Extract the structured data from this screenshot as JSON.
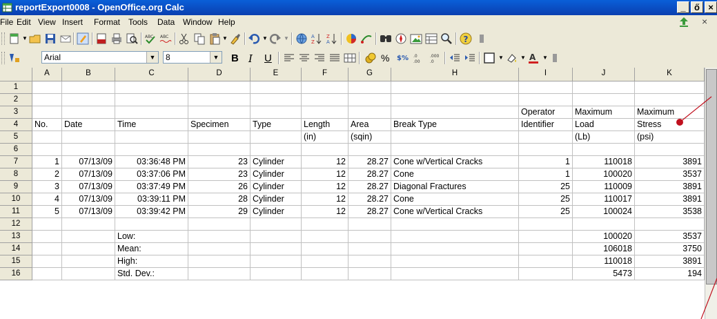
{
  "window": {
    "title": "reportExport0008 - OpenOffice.org Calc",
    "btn_min": "_",
    "btn_max": "ő",
    "btn_close": "×"
  },
  "menubar": {
    "items": [
      "File",
      "Edit",
      "View",
      "Insert",
      "Format",
      "Tools",
      "Data",
      "Window",
      "Help"
    ],
    "close": "×"
  },
  "formatting": {
    "font_name": "Arial",
    "font_size": "8",
    "bold": "B",
    "italic": "I",
    "underline": "U"
  },
  "columns": [
    "A",
    "B",
    "C",
    "D",
    "E",
    "F",
    "G",
    "H",
    "I",
    "J",
    "K"
  ],
  "rows": [
    "1",
    "2",
    "3",
    "4",
    "5",
    "6",
    "7",
    "8",
    "9",
    "10",
    "11",
    "12",
    "13",
    "14",
    "15",
    "16"
  ],
  "sheet": {
    "r3": {
      "I": "Operator",
      "J": "Maximum",
      "K": "Maximum"
    },
    "r4": {
      "A": "No.",
      "B": "Date",
      "C": "Time",
      "D": "Specimen",
      "E": "Type",
      "F": "Length",
      "G": "Area",
      "H": "Break Type",
      "I": "Identifier",
      "J": "Load",
      "K": "Stress"
    },
    "r5": {
      "F": "(in)",
      "G": "(sqin)",
      "J": "(Lb)",
      "K": "(psi)"
    },
    "data": [
      {
        "no": "1",
        "date": "07/13/09",
        "time": "03:36:48 PM",
        "specimen": "23",
        "type": "Cylinder",
        "length": "12",
        "area": "28.27",
        "break": "Cone w/Vertical Cracks",
        "operator": "1",
        "load": "110018",
        "stress": "3891"
      },
      {
        "no": "2",
        "date": "07/13/09",
        "time": "03:37:06 PM",
        "specimen": "23",
        "type": "Cylinder",
        "length": "12",
        "area": "28.27",
        "break": "Cone",
        "operator": "1",
        "load": "100020",
        "stress": "3537"
      },
      {
        "no": "3",
        "date": "07/13/09",
        "time": "03:37:49 PM",
        "specimen": "26",
        "type": "Cylinder",
        "length": "12",
        "area": "28.27",
        "break": "Diagonal Fractures",
        "operator": "25",
        "load": "110009",
        "stress": "3891"
      },
      {
        "no": "4",
        "date": "07/13/09",
        "time": "03:39:11 PM",
        "specimen": "28",
        "type": "Cylinder",
        "length": "12",
        "area": "28.27",
        "break": "Cone",
        "operator": "25",
        "load": "110017",
        "stress": "3891"
      },
      {
        "no": "5",
        "date": "07/13/09",
        "time": "03:39:42 PM",
        "specimen": "29",
        "type": "Cylinder",
        "length": "12",
        "area": "28.27",
        "break": "Cone w/Vertical Cracks",
        "operator": "25",
        "load": "100024",
        "stress": "3538"
      }
    ],
    "stats": [
      {
        "label": "Low:",
        "load": "100020",
        "stress": "3537"
      },
      {
        "label": "Mean:",
        "load": "106018",
        "stress": "3750"
      },
      {
        "label": "High:",
        "load": "110018",
        "stress": "3891"
      },
      {
        "label": "Std. Dev.:",
        "load": "5473",
        "stress": "194"
      }
    ]
  },
  "colors": {
    "titlebar": "#0a4fc8",
    "annotation": "#c0101e"
  }
}
